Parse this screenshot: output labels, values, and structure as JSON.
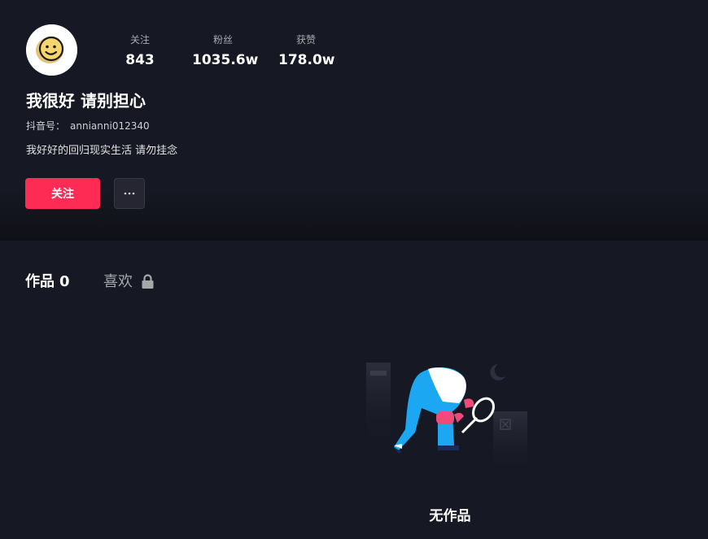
{
  "profile": {
    "stats": [
      {
        "label": "关注",
        "value": "843"
      },
      {
        "label": "粉丝",
        "value": "1035.6w"
      },
      {
        "label": "获赞",
        "value": "178.0w"
      }
    ],
    "name": "我很好 请别担心",
    "uid_label": "抖音号：",
    "uid_value": "annianni012340",
    "bio": "我好好的回归现实生活 请勿挂念",
    "follow_label": "关注",
    "more_label": "···"
  },
  "tabs": {
    "works_label": "作品",
    "works_count": "0",
    "likes_label": "喜欢"
  },
  "empty_state": {
    "text": "无作品"
  },
  "colors": {
    "background": "#161823",
    "accent": "#fe2c55",
    "illustration_blue": "#1ca7f2",
    "illustration_pink": "#f04a7a"
  }
}
